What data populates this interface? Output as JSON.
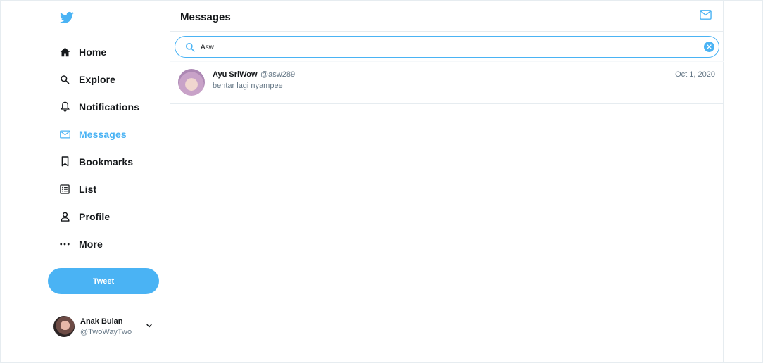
{
  "sidebar": {
    "logo": "twitter-bird-icon",
    "items": [
      {
        "label": "Home",
        "icon": "home-icon",
        "active": false
      },
      {
        "label": "Explore",
        "icon": "search-icon",
        "active": false
      },
      {
        "label": "Notifications",
        "icon": "bell-icon",
        "active": false
      },
      {
        "label": "Messages",
        "icon": "envelope-icon",
        "active": true
      },
      {
        "label": "Bookmarks",
        "icon": "bookmark-icon",
        "active": false
      },
      {
        "label": "List",
        "icon": "list-icon",
        "active": false
      },
      {
        "label": "Profile",
        "icon": "person-icon",
        "active": false
      },
      {
        "label": "More",
        "icon": "more-dots-icon",
        "active": false
      }
    ],
    "tweet_label": "Tweet",
    "account": {
      "display_name": "Anak Bulan",
      "handle": "@TwoWayTwo"
    }
  },
  "main": {
    "title": "Messages",
    "search": {
      "value": "Asw"
    },
    "results": [
      {
        "name": "Ayu SriWow",
        "handle": "@asw289",
        "date": "Oct 1, 2020",
        "preview": "bentar lagi nyampee"
      }
    ]
  },
  "colors": {
    "accent": "#4ab3f4",
    "text": "#14171a",
    "muted": "#657786",
    "border": "#e6ecf0"
  }
}
